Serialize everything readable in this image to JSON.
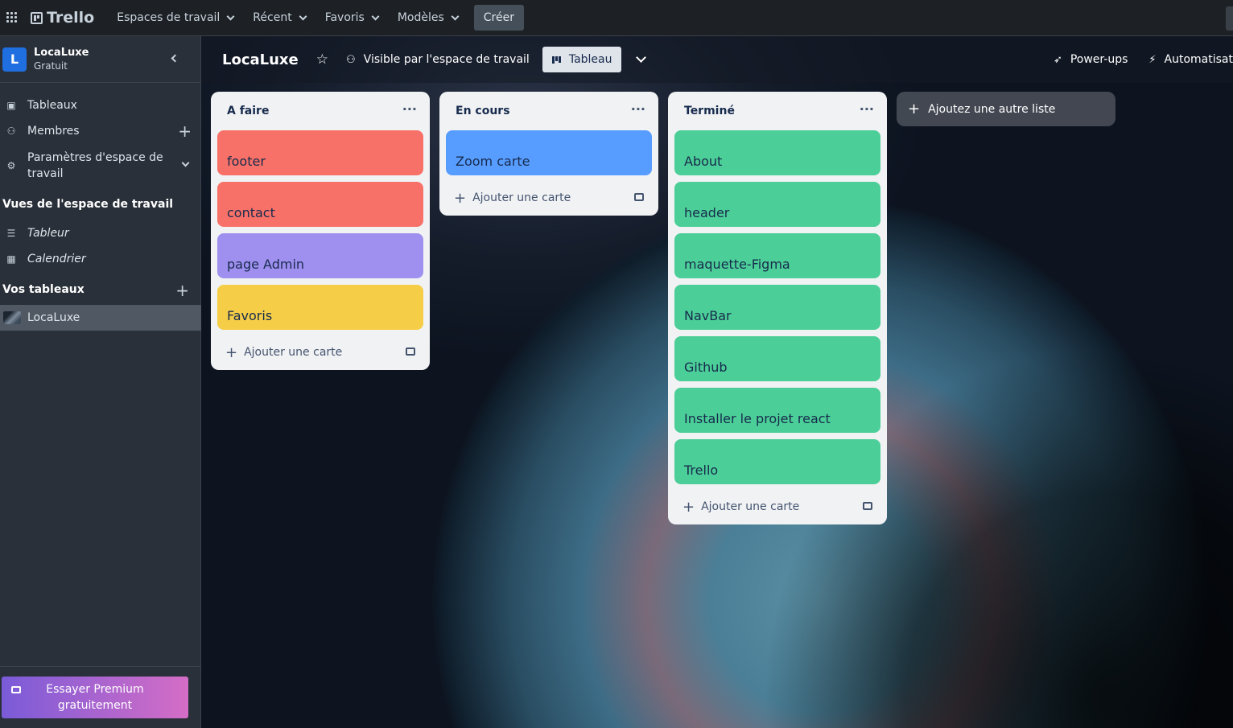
{
  "topnav": {
    "logo": "Trello",
    "menus": [
      "Espaces de travail",
      "Récent",
      "Favoris",
      "Modèles"
    ],
    "create_label": "Créer"
  },
  "sidebar": {
    "workspace_initial": "L",
    "workspace_name": "LocaLuxe",
    "workspace_plan": "Gratuit",
    "items": [
      {
        "label": "Tableaux",
        "icon": "board-icon"
      },
      {
        "label": "Membres",
        "icon": "person-icon"
      },
      {
        "label": "Paramètres d'espace de travail",
        "icon": "gear-icon"
      }
    ],
    "views_heading": "Vues de l'espace de travail",
    "views": [
      {
        "label": "Tableur",
        "icon": "table-icon"
      },
      {
        "label": "Calendrier",
        "icon": "calendar-icon"
      }
    ],
    "boards_heading": "Vos tableaux",
    "boards": [
      "LocaLuxe"
    ],
    "premium_label_line1": "Essayer Premium",
    "premium_label_line2": "gratuitement"
  },
  "board": {
    "title": "LocaLuxe",
    "visibility": "Visible par l'espace de travail",
    "view": "Tableau",
    "powerups": "Power-ups",
    "automation": "Automatisat",
    "add_list_label": "Ajoutez une autre liste",
    "add_card_label": "Ajouter une carte",
    "lists": [
      {
        "name": "A faire",
        "cards": [
          {
            "title": "footer",
            "color": "#f87168"
          },
          {
            "title": "contact",
            "color": "#f87168"
          },
          {
            "title": "page Admin",
            "color": "#9f8fef"
          },
          {
            "title": "Favoris",
            "color": "#f5cd47"
          }
        ]
      },
      {
        "name": "En cours",
        "cards": [
          {
            "title": "Zoom carte",
            "color": "#579dff"
          }
        ]
      },
      {
        "name": "Terminé",
        "cards": [
          {
            "title": "About",
            "color": "#4bce97"
          },
          {
            "title": "header",
            "color": "#4bce97"
          },
          {
            "title": "maquette-Figma",
            "color": "#4bce97"
          },
          {
            "title": "NavBar",
            "color": "#4bce97"
          },
          {
            "title": "Github",
            "color": "#4bce97"
          },
          {
            "title": "Installer le projet react",
            "color": "#4bce97"
          },
          {
            "title": "Trello",
            "color": "#4bce97"
          }
        ]
      }
    ]
  }
}
